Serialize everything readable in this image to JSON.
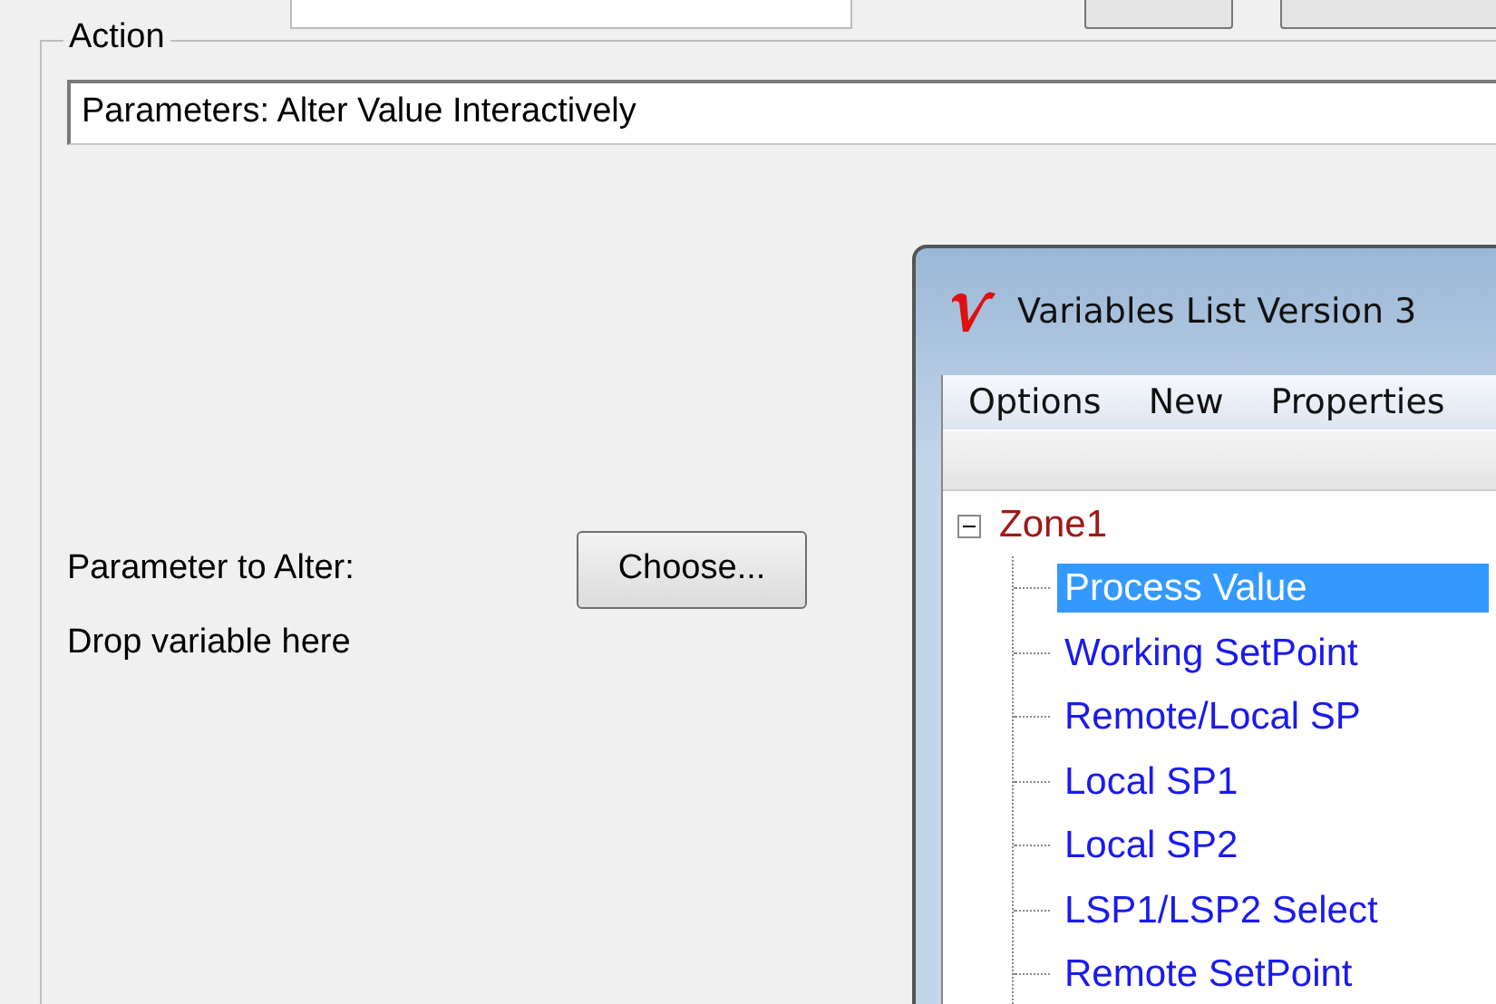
{
  "group": {
    "title": "Action"
  },
  "action_field": {
    "value": "Parameters: Alter Value Interactively"
  },
  "parameter_label": "Parameter to Alter:",
  "choose_button": "Choose...",
  "drop_hint": "Drop variable here",
  "variables_window": {
    "title": "Variables List Version 3",
    "menu": [
      "Options",
      "New",
      "Properties"
    ],
    "tree": [
      {
        "label": "Zone1",
        "expanded": true,
        "children": [
          {
            "label": "Process Value",
            "selected": true
          },
          {
            "label": "Working SetPoint",
            "selected": false
          },
          {
            "label": "Remote/Local SP",
            "selected": false
          },
          {
            "label": "Local SP1",
            "selected": false
          },
          {
            "label": "Local SP2",
            "selected": false
          },
          {
            "label": "LSP1/LSP2 Select",
            "selected": false
          },
          {
            "label": "Remote SetPoint",
            "selected": false
          }
        ]
      }
    ]
  }
}
